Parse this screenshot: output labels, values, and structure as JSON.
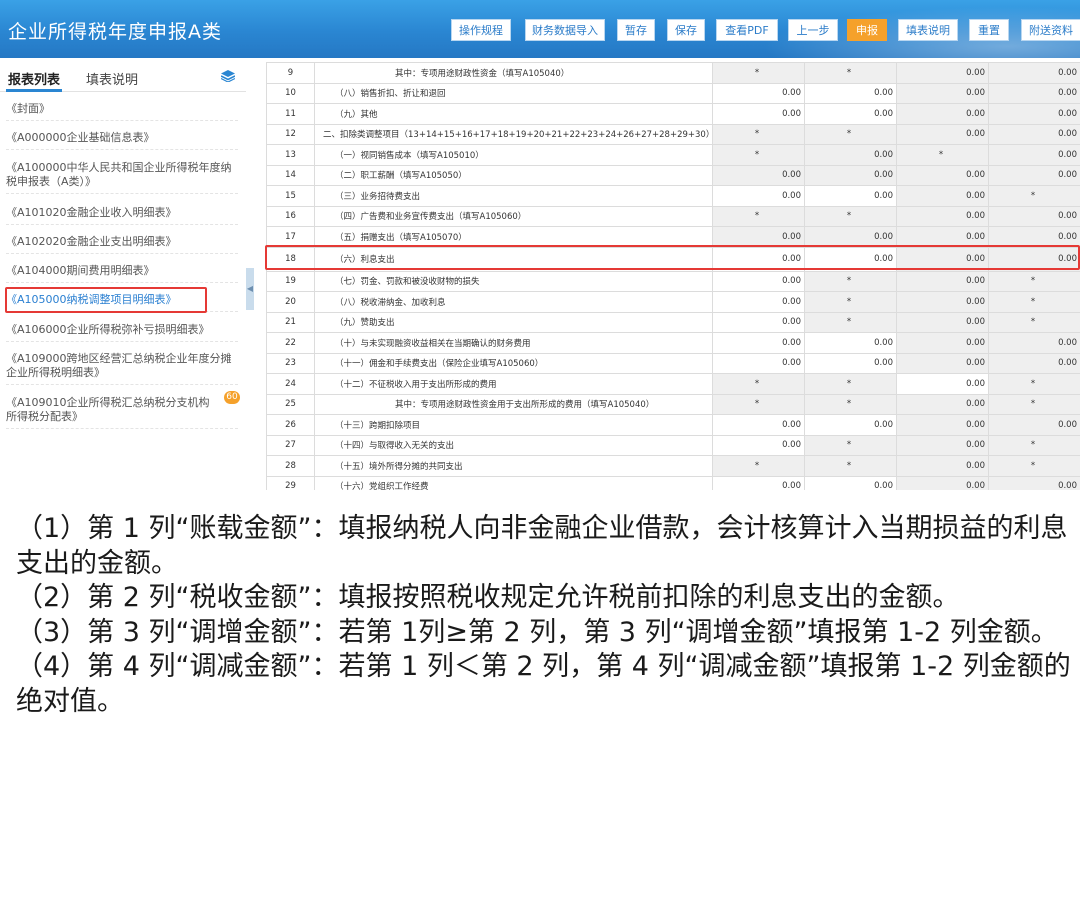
{
  "app": {
    "title": "企业所得税年度申报A类"
  },
  "toolbar": {
    "buttons": [
      {
        "label": "操作规程",
        "active": false
      },
      {
        "label": "财务数据导入",
        "active": false
      },
      {
        "label": "暂存",
        "active": false
      },
      {
        "label": "保存",
        "active": false
      },
      {
        "label": "查看PDF",
        "active": false
      },
      {
        "label": "上一步",
        "active": false
      },
      {
        "label": "申报",
        "active": true
      },
      {
        "label": "填表说明",
        "active": false
      },
      {
        "label": "重置",
        "active": false
      },
      {
        "label": "附送资料",
        "active": false
      }
    ]
  },
  "sidebar": {
    "tab_forms": "报表列表",
    "tab_instructions": "填表说明",
    "icon": "layers-icon",
    "items": [
      {
        "label": "《封面》"
      },
      {
        "label": "《A000000企业基础信息表》"
      },
      {
        "label": "《A100000中华人民共和国企业所得税年度纳税申报表（A类）》"
      },
      {
        "label": "《A101020金融企业收入明细表》"
      },
      {
        "label": "《A102020金融企业支出明细表》"
      },
      {
        "label": "《A104000期间费用明细表》"
      },
      {
        "label": "《A105000纳税调整项目明细表》",
        "current": true
      },
      {
        "label": "《A106000企业所得税弥补亏损明细表》"
      },
      {
        "label": "《A109000跨地区经营汇总纳税企业年度分摊企业所得税明细表》"
      },
      {
        "label": "《A109010企业所得税汇总纳税分支机构所得税分配表》"
      }
    ],
    "badge": "60"
  },
  "table": {
    "rows": [
      {
        "num": "9",
        "name": "其中：专项用途财政性资金（填写A105040）",
        "indent": 2,
        "v": [
          "*",
          "*",
          "0.00",
          "0.00"
        ],
        "g": [
          1,
          1,
          1,
          1
        ]
      },
      {
        "num": "10",
        "name": "（八）销售折扣、折让和退回",
        "indent": 1,
        "v": [
          "0.00",
          "0.00",
          "0.00",
          "0.00"
        ],
        "g": [
          0,
          0,
          1,
          1
        ]
      },
      {
        "num": "11",
        "name": "（九）其他",
        "indent": 1,
        "v": [
          "0.00",
          "0.00",
          "0.00",
          "0.00"
        ],
        "g": [
          0,
          0,
          1,
          1
        ]
      },
      {
        "num": "12",
        "name": "二、扣除类调整项目（13+14+15+16+17+18+19+20+21+22+23+24+26+27+28+29+30）",
        "indent": 0,
        "v": [
          "*",
          "*",
          "0.00",
          "0.00"
        ],
        "g": [
          1,
          1,
          1,
          1
        ]
      },
      {
        "num": "13",
        "name": "（一）视同销售成本（填写A105010）",
        "indent": 1,
        "v": [
          "*",
          "0.00",
          "*",
          "0.00"
        ],
        "g": [
          1,
          1,
          1,
          1
        ]
      },
      {
        "num": "14",
        "name": "（二）职工薪酬（填写A105050）",
        "indent": 1,
        "v": [
          "0.00",
          "0.00",
          "0.00",
          "0.00"
        ],
        "g": [
          1,
          1,
          1,
          1
        ]
      },
      {
        "num": "15",
        "name": "（三）业务招待费支出",
        "indent": 1,
        "v": [
          "0.00",
          "0.00",
          "0.00",
          "*"
        ],
        "g": [
          0,
          0,
          1,
          1
        ]
      },
      {
        "num": "16",
        "name": "（四）广告费和业务宣传费支出（填写A105060）",
        "indent": 1,
        "v": [
          "*",
          "*",
          "0.00",
          "0.00"
        ],
        "g": [
          1,
          1,
          1,
          1
        ]
      },
      {
        "num": "17",
        "name": "（五）捐赠支出（填写A105070）",
        "indent": 1,
        "v": [
          "0.00",
          "0.00",
          "0.00",
          "0.00"
        ],
        "g": [
          1,
          1,
          1,
          1
        ]
      },
      {
        "num": "18",
        "name": "（六）利息支出",
        "indent": 1,
        "v": [
          "0.00",
          "0.00",
          "0.00",
          "0.00"
        ],
        "g": [
          0,
          0,
          1,
          1
        ],
        "highlighted": true
      },
      {
        "num": "19",
        "name": "（七）罚金、罚款和被没收财物的损失",
        "indent": 1,
        "v": [
          "0.00",
          "*",
          "0.00",
          "*"
        ],
        "g": [
          0,
          1,
          1,
          1
        ]
      },
      {
        "num": "20",
        "name": "（八）税收滞纳金、加收利息",
        "indent": 1,
        "v": [
          "0.00",
          "*",
          "0.00",
          "*"
        ],
        "g": [
          0,
          1,
          1,
          1
        ]
      },
      {
        "num": "21",
        "name": "（九）赞助支出",
        "indent": 1,
        "v": [
          "0.00",
          "*",
          "0.00",
          "*"
        ],
        "g": [
          0,
          1,
          1,
          1
        ]
      },
      {
        "num": "22",
        "name": "（十）与未实现融资收益相关在当期确认的财务费用",
        "indent": 1,
        "v": [
          "0.00",
          "0.00",
          "0.00",
          "0.00"
        ],
        "g": [
          0,
          0,
          1,
          1
        ]
      },
      {
        "num": "23",
        "name": "（十一）佣金和手续费支出（保险企业填写A105060）",
        "indent": 1,
        "v": [
          "0.00",
          "0.00",
          "0.00",
          "0.00"
        ],
        "g": [
          0,
          0,
          1,
          1
        ]
      },
      {
        "num": "24",
        "name": "（十二）不征税收入用于支出所形成的费用",
        "indent": 1,
        "v": [
          "*",
          "*",
          "0.00",
          "*"
        ],
        "g": [
          1,
          1,
          0,
          1
        ]
      },
      {
        "num": "25",
        "name": "其中：专项用途财政性资金用于支出所形成的费用（填写A105040）",
        "indent": 2,
        "v": [
          "*",
          "*",
          "0.00",
          "*"
        ],
        "g": [
          1,
          1,
          1,
          1
        ]
      },
      {
        "num": "26",
        "name": "（十三）跨期扣除项目",
        "indent": 1,
        "v": [
          "0.00",
          "0.00",
          "0.00",
          "0.00"
        ],
        "g": [
          0,
          0,
          1,
          1
        ]
      },
      {
        "num": "27",
        "name": "（十四）与取得收入无关的支出",
        "indent": 1,
        "v": [
          "0.00",
          "*",
          "0.00",
          "*"
        ],
        "g": [
          0,
          1,
          1,
          1
        ]
      },
      {
        "num": "28",
        "name": "（十五）境外所得分摊的共同支出",
        "indent": 1,
        "v": [
          "*",
          "*",
          "0.00",
          "*"
        ],
        "g": [
          1,
          1,
          1,
          1
        ]
      },
      {
        "num": "29",
        "name": "（十六）党组织工作经费",
        "indent": 1,
        "v": [
          "0.00",
          "0.00",
          "0.00",
          "0.00"
        ],
        "g": [
          0,
          0,
          1,
          1
        ]
      }
    ]
  },
  "description": {
    "paragraphs": [
      "（1）第 1 列“账载金额”：填报纳税人向非金融企业借款，会计核算计入当期损益的利息支出的金额。",
      "（2）第 2 列“税收金额”：填报按照税收规定允许税前扣除的利息支出的金额。",
      "（3）第 3 列“调增金额”：若第 1列≥第 2 列，第 3 列“调增金额”填报第 1-2 列金额。",
      "（4）第 4 列“调减金额”：若第 1 列＜第 2 列，第 4 列“调减金额”填报第 1-2 列金额的绝对值。"
    ]
  }
}
